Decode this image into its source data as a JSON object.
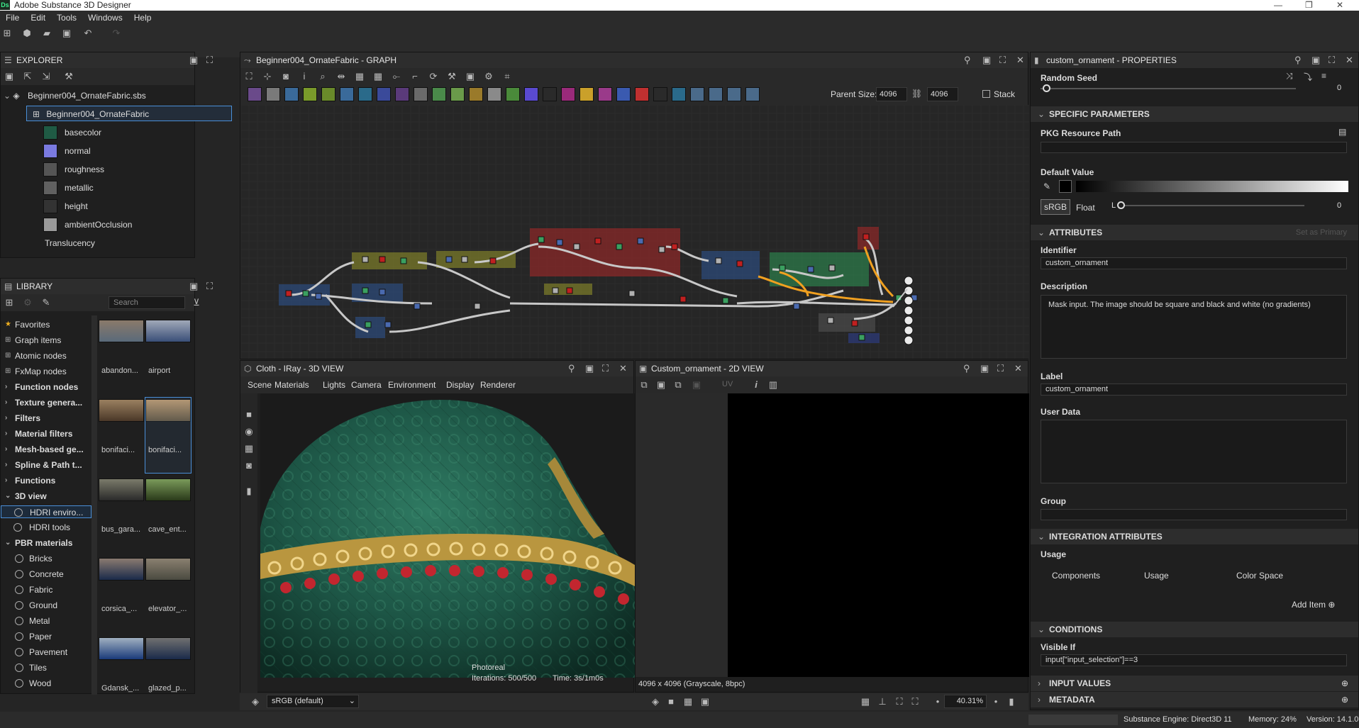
{
  "app": {
    "title": "Adobe Substance 3D Designer",
    "logo": "Ds"
  },
  "menu": [
    "File",
    "Edit",
    "Tools",
    "Windows",
    "Help"
  ],
  "explorer": {
    "title": "EXPLORER",
    "package": "Beginner004_OrnateFabric.sbs",
    "graph": "Beginner004_OrnateFabric",
    "outputs": [
      {
        "label": "basecolor",
        "color": "#1f5a44"
      },
      {
        "label": "normal",
        "color": "#7a7ae0"
      },
      {
        "label": "roughness",
        "color": "#555"
      },
      {
        "label": "metallic",
        "color": "#606060"
      },
      {
        "label": "height",
        "color": "#333"
      },
      {
        "label": "ambientOcclusion",
        "color": "#9a9a9a"
      },
      {
        "label": "Translucency",
        "color": ""
      }
    ]
  },
  "library": {
    "title": "LIBRARY",
    "search_placeholder": "Search",
    "categories": [
      {
        "label": "Favorites",
        "type": "star"
      },
      {
        "label": "Graph items",
        "type": "icon"
      },
      {
        "label": "Atomic nodes",
        "type": "icon"
      },
      {
        "label": "FxMap nodes",
        "type": "icon"
      },
      {
        "label": "Function nodes",
        "type": "group"
      },
      {
        "label": "Texture genera...",
        "type": "group"
      },
      {
        "label": "Filters",
        "type": "group"
      },
      {
        "label": "Material filters",
        "type": "group"
      },
      {
        "label": "Mesh-based ge...",
        "type": "group"
      },
      {
        "label": "Spline & Path t...",
        "type": "group"
      },
      {
        "label": "Functions",
        "type": "group"
      },
      {
        "label": "3D view",
        "type": "open"
      },
      {
        "label": "HDRI enviro...",
        "type": "circle",
        "selected": true
      },
      {
        "label": "HDRI tools",
        "type": "circle"
      },
      {
        "label": "PBR materials",
        "type": "open"
      },
      {
        "label": "Bricks",
        "type": "circle"
      },
      {
        "label": "Concrete",
        "type": "circle"
      },
      {
        "label": "Fabric",
        "type": "circle"
      },
      {
        "label": "Ground",
        "type": "circle"
      },
      {
        "label": "Metal",
        "type": "circle"
      },
      {
        "label": "Paper",
        "type": "circle"
      },
      {
        "label": "Pavement",
        "type": "circle"
      },
      {
        "label": "Tiles",
        "type": "circle"
      },
      {
        "label": "Wood",
        "type": "circle"
      }
    ],
    "thumbs": [
      "abandon...",
      "airport",
      "bonifaci...",
      "bonifaci...",
      "bus_gara...",
      "cave_ent...",
      "corsica_...",
      "elevator_...",
      "Gdansk_...",
      "glazed_p..."
    ]
  },
  "graph": {
    "title": "Beginner004_OrnateFabric - GRAPH",
    "parent_size_label": "Parent Size:",
    "parent_size": "4096",
    "size": "4096",
    "stack_label": "Stack"
  },
  "view3d": {
    "title": "Cloth - IRay - 3D VIEW",
    "menu": [
      "Scene",
      "Materials",
      "Lights",
      "Camera",
      "Environment",
      "Display",
      "Renderer"
    ],
    "render_mode": "Photoreal",
    "iterations": "Iterations: 500/500",
    "time": "Time: 3s/1m0s",
    "colorspace": "sRGB (default)"
  },
  "view2d": {
    "title": "Custom_ornament - 2D VIEW",
    "uv": "UV",
    "info": "4096 x 4096 (Grayscale, 8bpc)",
    "zoom": "40.31%"
  },
  "props": {
    "title": "custom_ornament - PROPERTIES",
    "random_seed_label": "Random Seed",
    "random_seed": "0",
    "specific": "SPECIFIC PARAMETERS",
    "pkg_path_label": "PKG Resource Path",
    "default_value_label": "Default Value",
    "srgb": "sRGB",
    "float": "Float",
    "lo": "L",
    "default_value": "0",
    "attributes": "ATTRIBUTES",
    "set_primary": "Set as Primary",
    "identifier_label": "Identifier",
    "identifier": "custom_ornament",
    "description_label": "Description",
    "description": "Mask input. The image should be square and black and white (no gradients)",
    "label_label": "Label",
    "label": "custom_ornament",
    "userdata_label": "User Data",
    "group_label": "Group",
    "integration": "INTEGRATION ATTRIBUTES",
    "usage_label": "Usage",
    "cols": [
      "Components",
      "Usage",
      "Color Space"
    ],
    "add_item": "Add Item",
    "conditions": "CONDITIONS",
    "visible_if_label": "Visible If",
    "visible_if": "input[\"input_selection\"]==3",
    "input_values": "INPUT VALUES",
    "metadata": "METADATA"
  },
  "status": {
    "engine": "Substance Engine: Direct3D 11",
    "memory": "Memory: 24%",
    "version": "Version: 14.1.0"
  }
}
